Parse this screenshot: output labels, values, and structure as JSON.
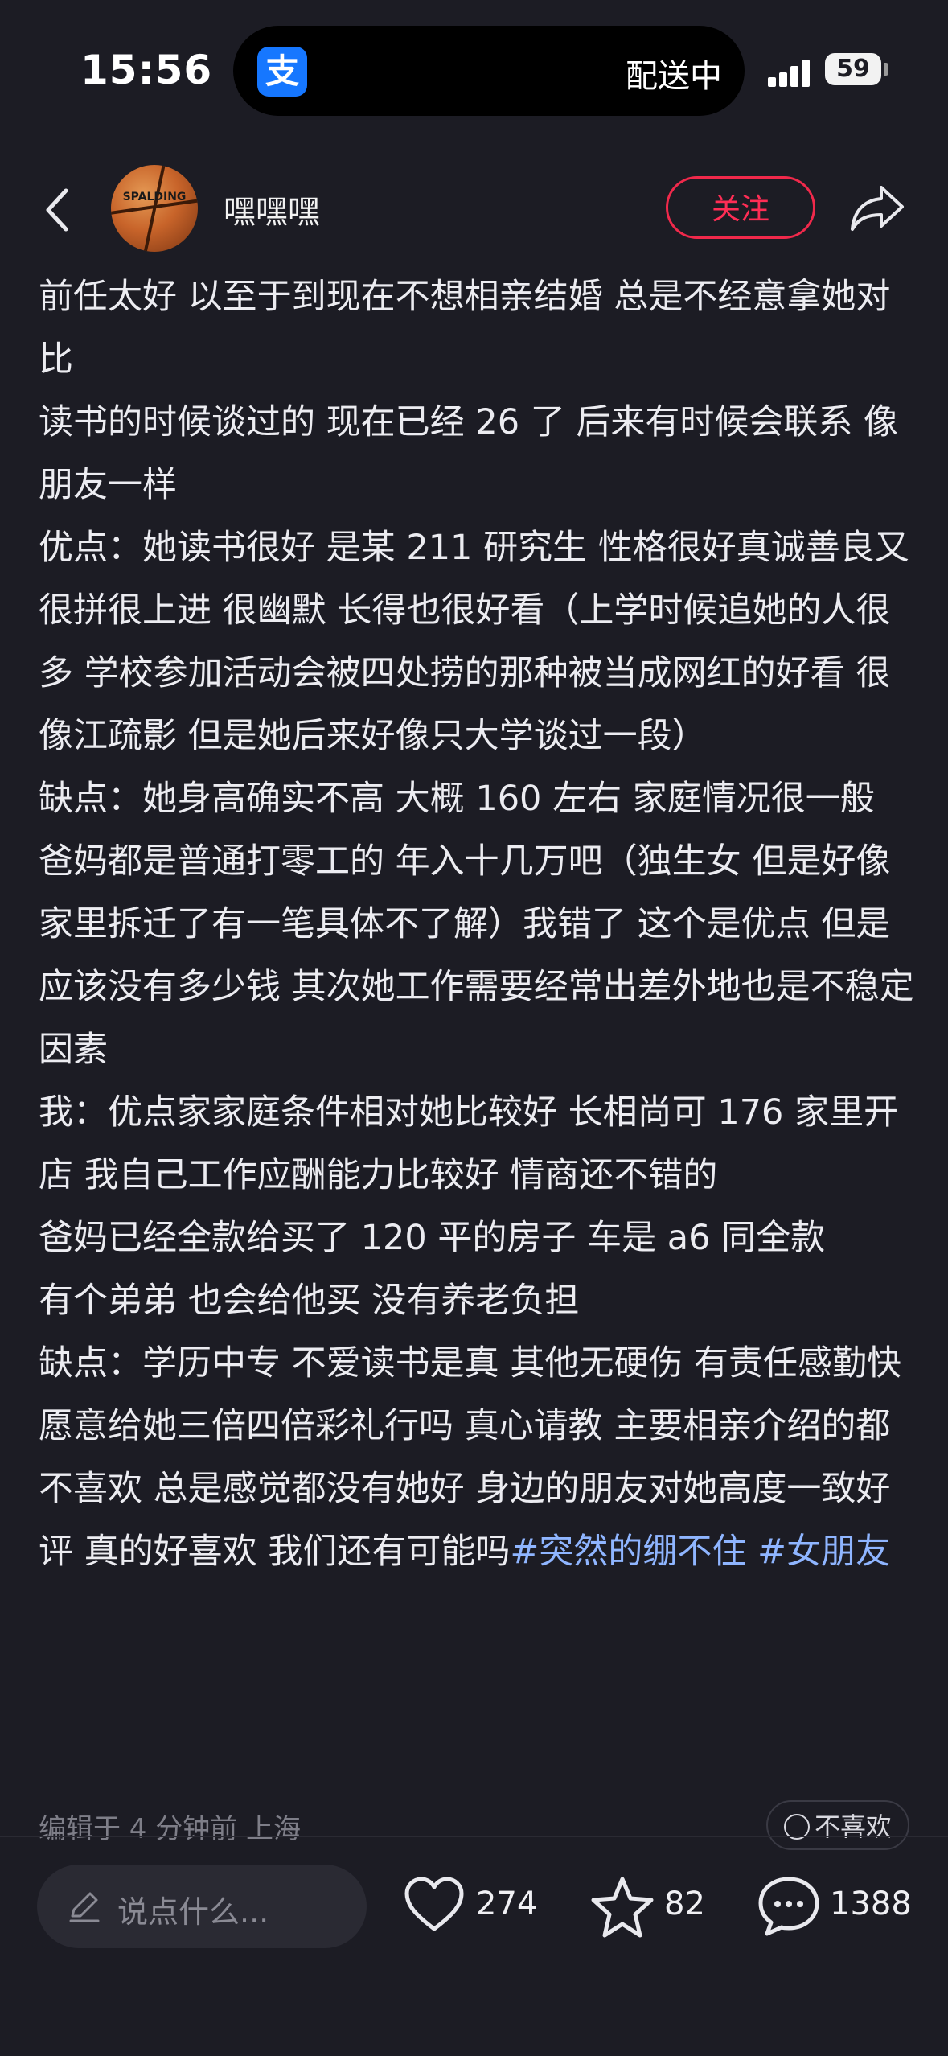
{
  "status_bar": {
    "time": "15:56",
    "app_icon_label": "支",
    "activity_text": "配送中",
    "battery": "59"
  },
  "header": {
    "back_icon": "chevron-left-icon",
    "avatar_brand": "SPALDING",
    "username": "嘿嘿嘿",
    "follow_label": "关注",
    "share_icon": "share-arrow-icon",
    "accent_color": "#ff2d55"
  },
  "post": {
    "paragraphs": [
      "前任太好 以至于到现在不想相亲结婚 总是不经意拿她对比",
      "读书的时候谈过的 现在已经 26 了 后来有时候会联系 像朋友一样",
      "优点：她读书很好 是某 211 研究生 性格很好真诚善良又很拼很上进 很幽默 长得也很好看（上学时候追她的人很多 学校参加活动会被四处捞的那种被当成网红的好看 很像江疏影 但是她后来好像只大学谈过一段）",
      "缺点：她身高确实不高 大概 160 左右 家庭情况很一般 爸妈都是普通打零工的 年入十几万吧（独生女 但是好像家里拆迁了有一笔具体不了解）我错了 这个是优点 但是应该没有多少钱 其次她工作需要经常出差外地也是不稳定因素",
      "我：优点家家庭条件相对她比较好 长相尚可 176 家里开店 我自己工作应酬能力比较好 情商还不错的",
      "爸妈已经全款给买了 120 平的房子 车是 a6 同全款",
      "有个弟弟 也会给他买 没有养老负担",
      "缺点：学历中专 不爱读书是真 其他无硬伤 有责任感勤快"
    ],
    "last_paragraph": "愿意给她三倍四倍彩礼行吗 真心请教 主要相亲介绍的都不喜欢 总是感觉都没有她好 身边的朋友对她高度一致好评 真的好喜欢 我们还有可能吗",
    "tags": [
      "#突然的绷不住",
      "#女朋友"
    ],
    "tag_color": "#8fb5ff",
    "edit_info": "编辑于 4 分钟前 上海",
    "dislike_label": "不喜欢"
  },
  "bottom_bar": {
    "comment_placeholder": "说点什么...",
    "likes": "274",
    "favorites": "82",
    "comments": "1388"
  }
}
